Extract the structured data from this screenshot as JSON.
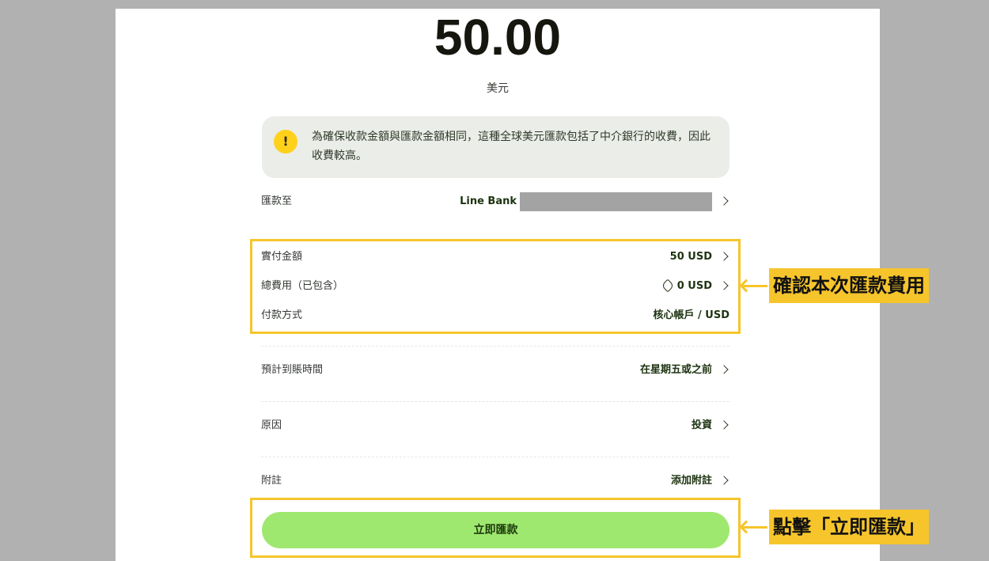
{
  "amount": "50.00",
  "currency_label": "美元",
  "notice": {
    "icon": "exclamation-icon",
    "icon_glyph": "!",
    "text": "為確保收款金額與匯款金額相同，這種全球美元匯款包括了中介銀行的收費，因此收費較高。"
  },
  "rows": {
    "recipient": {
      "label": "匯款至",
      "value": "Line Bank"
    },
    "paid_amount": {
      "label": "實付金額",
      "value": "50 USD"
    },
    "total_fee": {
      "label": "總費用（已包含）",
      "value": "0 USD",
      "icon": "tag-icon"
    },
    "payment_method": {
      "label": "付款方式",
      "value": "核心帳戶 / USD"
    },
    "arrival": {
      "label": "預計到賬時間",
      "value": "在星期五或之前"
    },
    "reason": {
      "label": "原因",
      "value": "投資"
    },
    "note": {
      "label": "附註",
      "value": "添加附註"
    }
  },
  "submit_label": "立即匯款",
  "annotations": {
    "fees": "確認本次匯款費用",
    "submit": "點擊「立即匯款」"
  },
  "colors": {
    "background": "#b1b1b1",
    "highlight": "#f6c52c",
    "button": "#9fe870",
    "notice_bg": "#ebede8",
    "notice_icon": "#ffd11a"
  }
}
